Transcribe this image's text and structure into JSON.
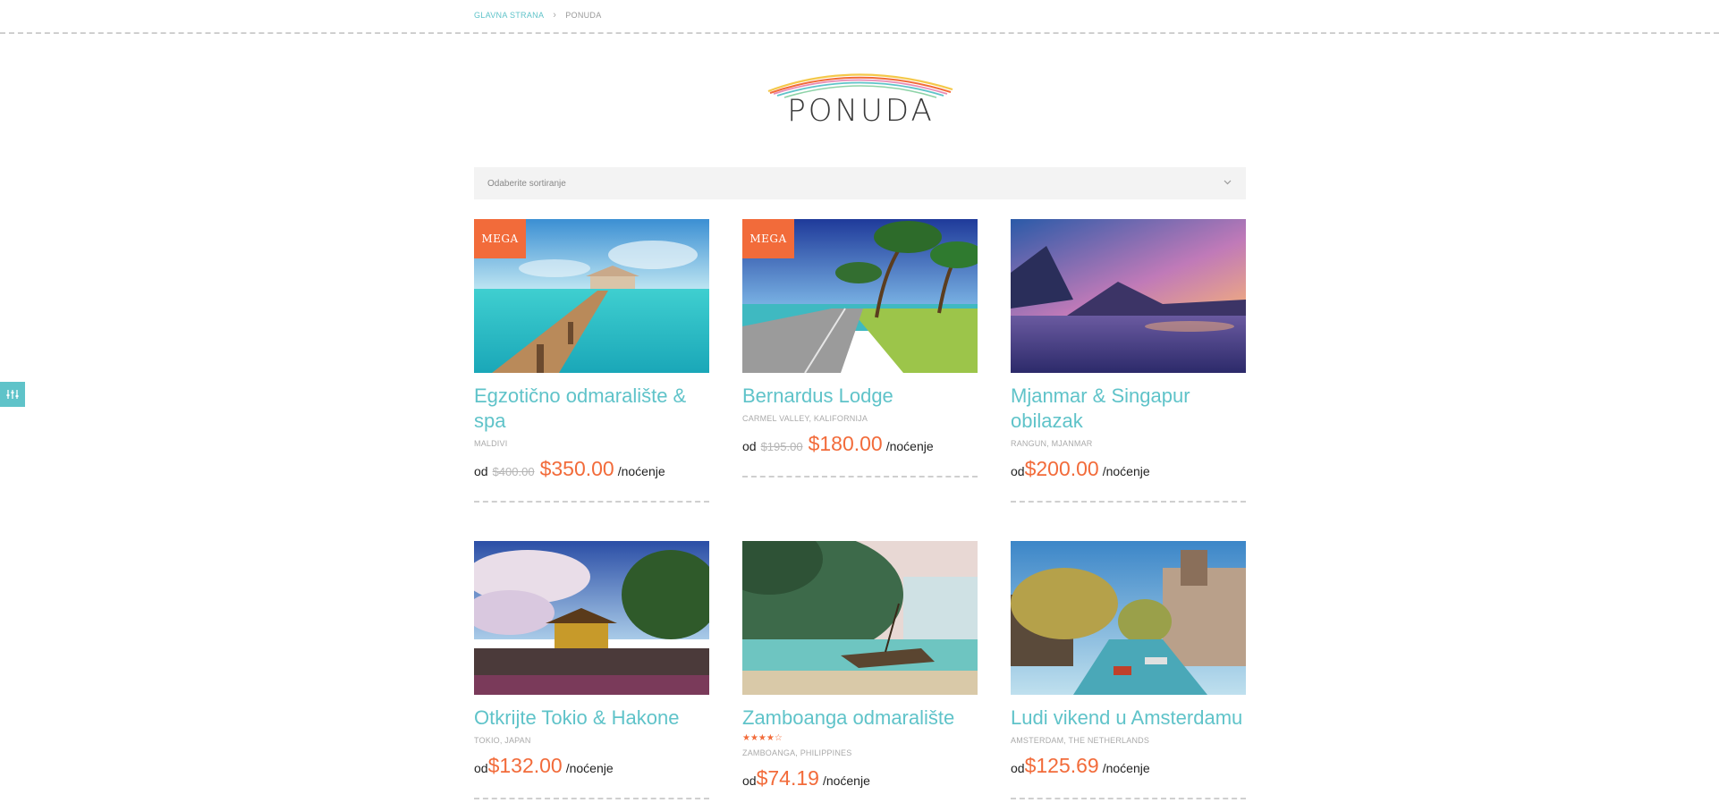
{
  "breadcrumb": {
    "home": "GLAVNA STRANA",
    "current": "PONUDA"
  },
  "page": {
    "title": "PONUDA"
  },
  "sort": {
    "placeholder": "Odaberite sortiranje"
  },
  "colors": {
    "accent": "#5fc3c9",
    "price": "#f26b3a",
    "badge": "#f26b3a"
  },
  "icons": {
    "side_toggle": "sliders-icon",
    "sort": "chevron-down-icon"
  },
  "products": [
    {
      "badge": "MEGA",
      "title_line1": "Egzotično odmaralište &",
      "title_line2": "spa",
      "location": "MALDIVI",
      "from": "od",
      "old_price": "$400.00",
      "price": "$350.00",
      "unit": "/noćenje"
    },
    {
      "badge": "MEGA",
      "title_line1": "Bernardus Lodge",
      "location": "CARMEL VALLEY, KALIFORNIJA",
      "from": "od",
      "old_price": "$195.00",
      "price": "$180.00",
      "unit": "/noćenje"
    },
    {
      "title_line1": "Mjanmar & Singapur",
      "title_line2": "obilazak",
      "location": "RANGUN, MJANMAR",
      "from": "od",
      "price": "$200.00",
      "unit": "/noćenje"
    },
    {
      "title_line1": "Otkrijte Tokio & Hakone",
      "location": "TOKIO, JAPAN",
      "from": "od",
      "price": "$132.00",
      "unit": "/noćenje"
    },
    {
      "title_line1": "Zamboanga odmaralište",
      "rating": 4,
      "rating_max": 5,
      "location": "ZAMBOANGA, PHILIPPINES",
      "from": "od",
      "price": "$74.19",
      "unit": "/noćenje"
    },
    {
      "title_line1": "Ludi vikend u Amsterdamu",
      "location": "AMSTERDAM, THE NETHERLANDS",
      "from": "od",
      "price": "$125.69",
      "unit": "/noćenje"
    }
  ]
}
